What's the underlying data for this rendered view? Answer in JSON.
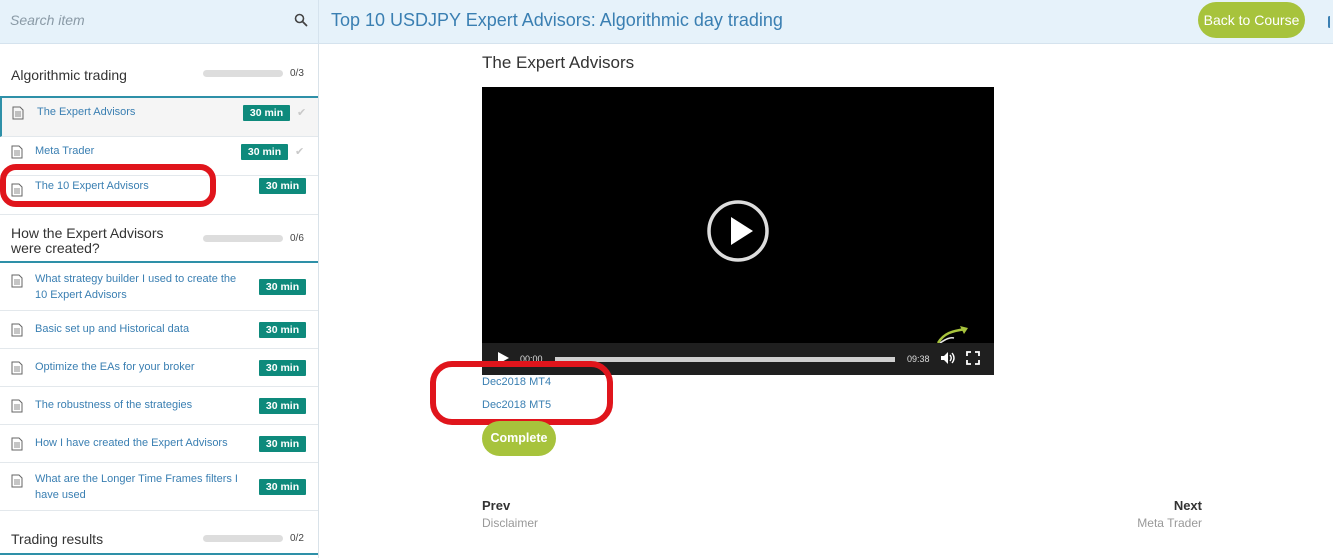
{
  "search": {
    "placeholder": "Search item",
    "icon": "search-icon"
  },
  "header": {
    "course_title": "Top 10 USDJPY Expert Advisors: Algorithmic day trading",
    "back_label": "Back to Course"
  },
  "colors": {
    "accent": "#2e90a8",
    "badge": "#0e8a7c",
    "button": "#a7c33c",
    "link": "#3a7fb2",
    "annotation": "#e0151c"
  },
  "sidebar": {
    "sections": [
      {
        "title": "Algorithmic trading",
        "count": "0/3",
        "progress": 0,
        "lessons": [
          {
            "title": "The Expert Advisors",
            "duration": "30 min",
            "completed": true,
            "active": true
          },
          {
            "title": "Meta Trader",
            "duration": "30 min",
            "completed": true,
            "active": false
          },
          {
            "title": "The 10 Expert Advisors",
            "duration": "30 min",
            "completed": false,
            "active": false
          }
        ]
      },
      {
        "title_line1": "How the Expert Advisors",
        "title_line2": "were created?",
        "count": "0/6",
        "progress": 0,
        "lessons": [
          {
            "title_line1": "What strategy builder I used to create the",
            "title_line2": "10 Expert Advisors",
            "duration": "30 min"
          },
          {
            "title": "Basic set up and Historical data",
            "duration": "30 min"
          },
          {
            "title": "Optimize the EAs for your broker",
            "duration": "30 min"
          },
          {
            "title": "The robustness of the strategies",
            "duration": "30 min"
          },
          {
            "title": "How I have created the Expert Advisors",
            "duration": "30 min"
          },
          {
            "title_line1": "What are the Longer Time Frames filters I",
            "title_line2": "have used",
            "duration": "30 min"
          }
        ]
      },
      {
        "title": "Trading results",
        "count": "0/2",
        "progress": 0
      }
    ]
  },
  "main": {
    "lesson_title": "The Expert Advisors",
    "video": {
      "current_time": "00:00",
      "duration": "09:38",
      "progress": 0
    },
    "downloads": [
      "Dec2018 MT4",
      "Dec2018 MT5"
    ],
    "complete_label": "Complete",
    "nav": {
      "prev_label": "Prev",
      "prev_title": "Disclaimer",
      "next_label": "Next",
      "next_title": "Meta Trader"
    }
  }
}
